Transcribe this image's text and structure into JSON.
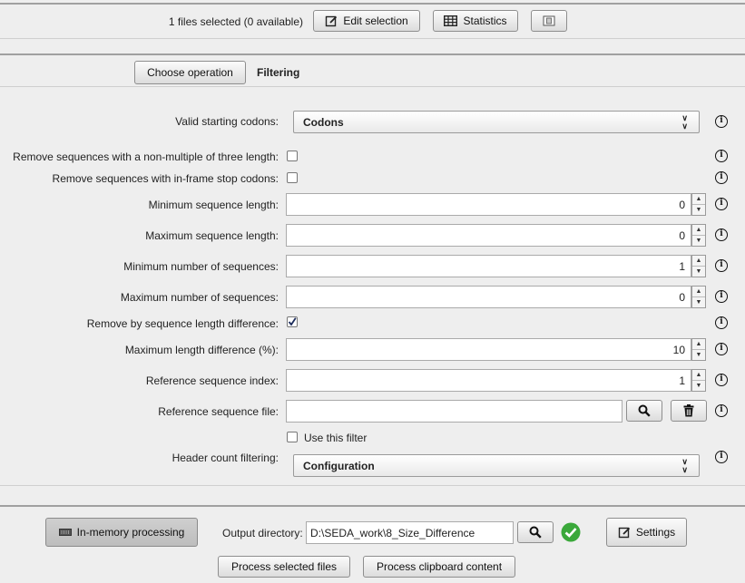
{
  "top_bar": {
    "files_status": "1 files selected (0 available)",
    "edit_selection_label": "Edit selection",
    "statistics_label": "Statistics"
  },
  "operation": {
    "choose_label": "Choose operation",
    "current_operation": "Filtering"
  },
  "form": {
    "valid_starting_codons_label": "Valid starting codons:",
    "valid_starting_codons_value": "Codons",
    "remove_non_multiple_label": "Remove sequences with a non-multiple of three length:",
    "remove_non_multiple_checked": false,
    "remove_stop_codons_label": "Remove sequences with in-frame stop codons:",
    "remove_stop_codons_checked": false,
    "min_seq_length_label": "Minimum sequence length:",
    "min_seq_length_value": "0",
    "max_seq_length_label": "Maximum sequence length:",
    "max_seq_length_value": "0",
    "min_num_seqs_label": "Minimum number of sequences:",
    "min_num_seqs_value": "1",
    "max_num_seqs_label": "Maximum number of sequences:",
    "max_num_seqs_value": "0",
    "remove_by_length_diff_label": "Remove by sequence length difference:",
    "remove_by_length_diff_checked": true,
    "max_length_diff_label": "Maximum length difference (%):",
    "max_length_diff_value": "10",
    "ref_seq_index_label": "Reference sequence index:",
    "ref_seq_index_value": "1",
    "ref_seq_file_label": "Reference sequence file:",
    "ref_seq_file_value": "",
    "use_this_filter_label": "Use this filter",
    "use_this_filter_checked": false,
    "header_count_label": "Header count filtering:",
    "header_count_value": "Configuration"
  },
  "bottom": {
    "in_memory_label": "In-memory processing",
    "output_dir_label": "Output directory:",
    "output_dir_value": "D:\\SEDA_work\\8_Size_Difference",
    "settings_label": "Settings",
    "process_selected_label": "Process selected files",
    "process_clipboard_label": "Process clipboard content"
  },
  "colors": {
    "status_ok": "#3aa83a",
    "background": "#eeeeee"
  }
}
